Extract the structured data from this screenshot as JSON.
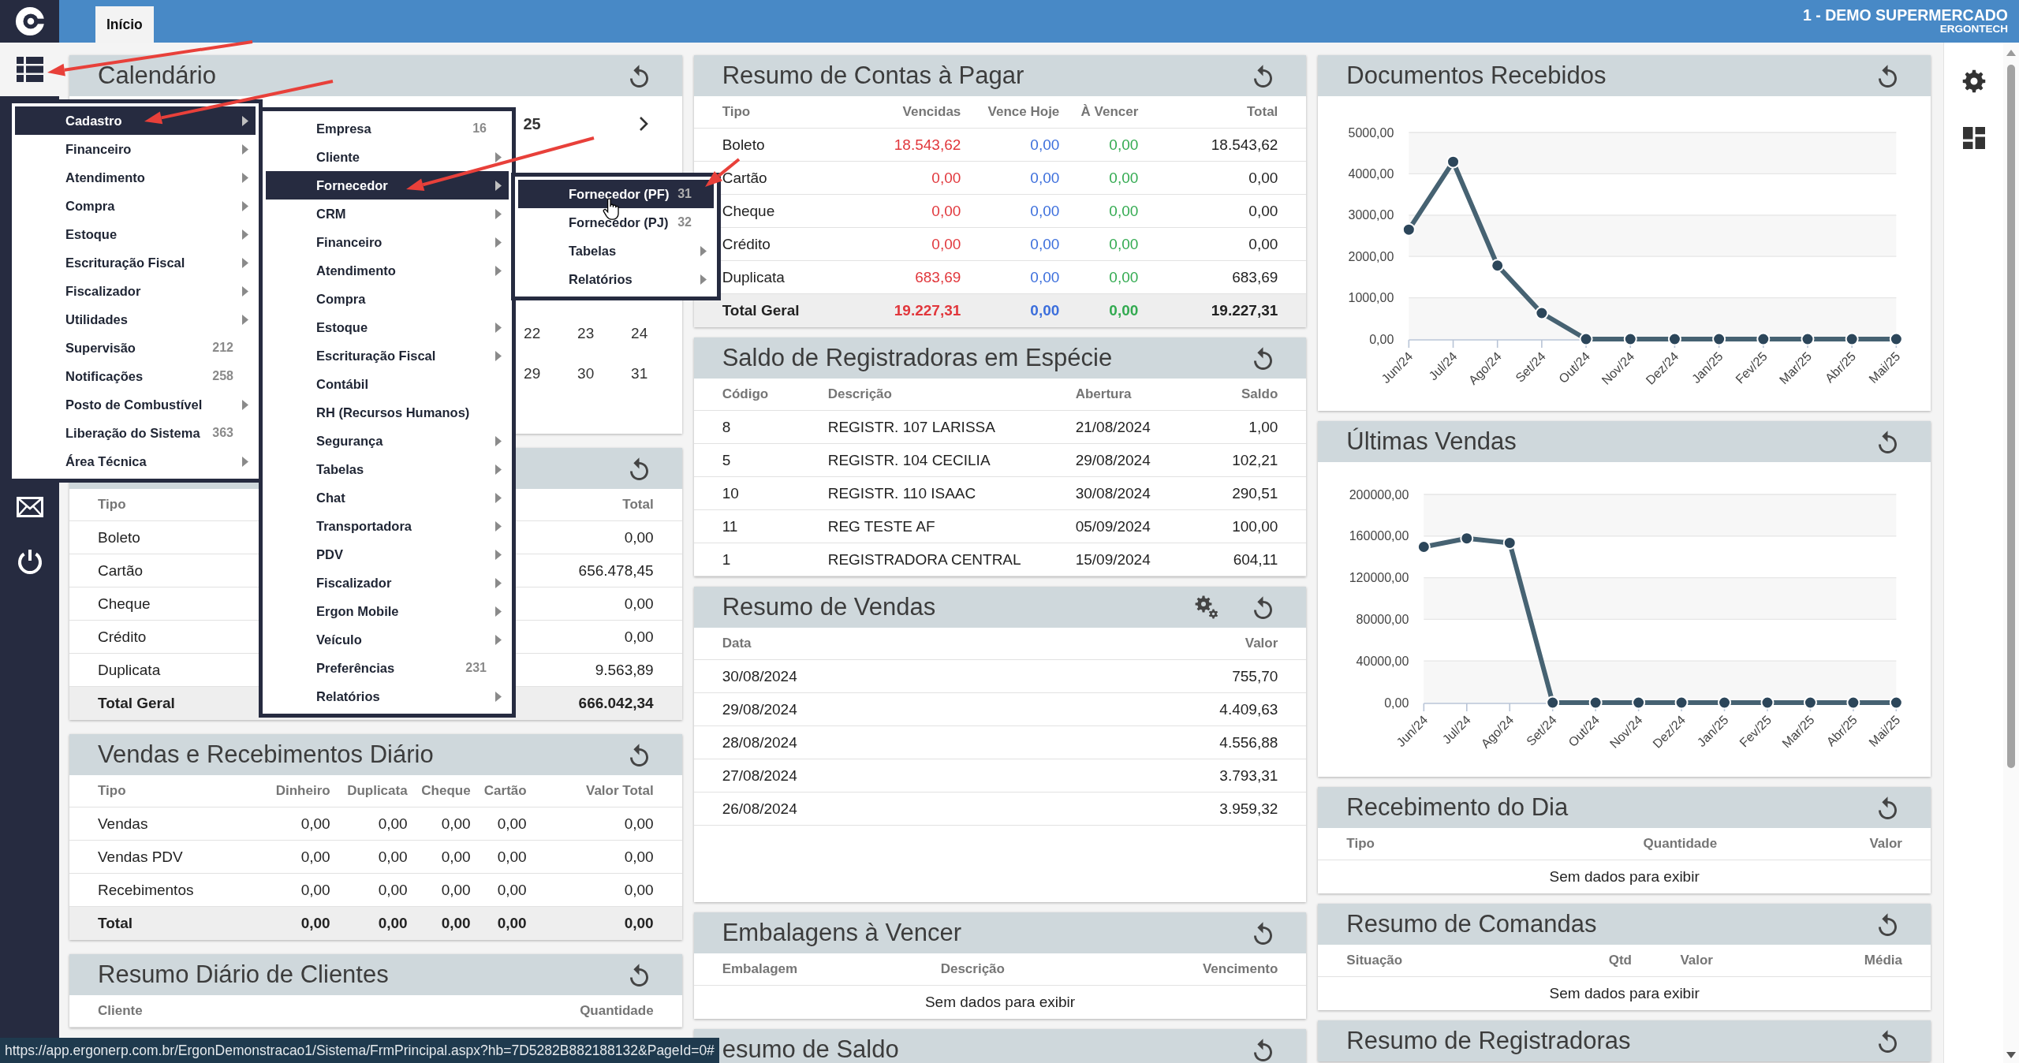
{
  "top_bar": {
    "tabs": [
      {
        "label": "Início",
        "selected": true
      }
    ],
    "company": "1 - DEMO SUPERMERCADO",
    "user": "ERGONTECH"
  },
  "sidebar": {
    "menu_button": {
      "active": true
    }
  },
  "menus": [
    {
      "items": [
        {
          "label": "Cadastro",
          "kind": "submenu",
          "selected": true
        },
        {
          "label": "Financeiro",
          "kind": "submenu",
          "selected": false
        },
        {
          "label": "Atendimento",
          "kind": "submenu",
          "selected": false
        },
        {
          "label": "Compra",
          "kind": "submenu",
          "selected": false
        },
        {
          "label": "Estoque",
          "kind": "submenu",
          "selected": false
        },
        {
          "label": "Escrituração Fiscal",
          "kind": "submenu",
          "selected": false
        },
        {
          "label": "Fiscalizador",
          "kind": "submenu",
          "selected": false
        },
        {
          "label": "Utilidades",
          "kind": "submenu",
          "selected": false
        },
        {
          "label": "Supervisão",
          "kind": "count",
          "count": "212",
          "selected": false
        },
        {
          "label": "Notificações",
          "kind": "count",
          "count": "258",
          "selected": false
        },
        {
          "label": "Posto de Combustível",
          "kind": "submenu",
          "selected": false
        },
        {
          "label": "Liberação do Sistema",
          "kind": "count",
          "count": "363",
          "selected": false
        },
        {
          "label": "Área Técnica",
          "kind": "submenu",
          "selected": false
        }
      ]
    },
    {
      "items": [
        {
          "label": "Empresa",
          "kind": "count",
          "count": "16",
          "selected": false
        },
        {
          "label": "Cliente",
          "kind": "submenu",
          "selected": false
        },
        {
          "label": "Fornecedor",
          "kind": "submenu",
          "selected": true
        },
        {
          "label": "CRM",
          "kind": "submenu",
          "selected": false
        },
        {
          "label": "Financeiro",
          "kind": "submenu",
          "selected": false
        },
        {
          "label": "Atendimento",
          "kind": "submenu",
          "selected": false
        },
        {
          "label": "Compra",
          "kind": "link",
          "selected": false
        },
        {
          "label": "Estoque",
          "kind": "submenu",
          "selected": false
        },
        {
          "label": "Escrituração Fiscal",
          "kind": "submenu",
          "selected": false
        },
        {
          "label": "Contábil",
          "kind": "link",
          "selected": false
        },
        {
          "label": "RH (Recursos Humanos)",
          "kind": "link",
          "selected": false
        },
        {
          "label": "Segurança",
          "kind": "submenu",
          "selected": false
        },
        {
          "label": "Tabelas",
          "kind": "submenu",
          "selected": false
        },
        {
          "label": "Chat",
          "kind": "submenu",
          "selected": false
        },
        {
          "label": "Transportadora",
          "kind": "submenu",
          "selected": false
        },
        {
          "label": "PDV",
          "kind": "submenu",
          "selected": false
        },
        {
          "label": "Fiscalizador",
          "kind": "submenu",
          "selected": false
        },
        {
          "label": "Ergon Mobile",
          "kind": "submenu",
          "selected": false
        },
        {
          "label": "Veículo",
          "kind": "submenu",
          "selected": false
        },
        {
          "label": "Preferências",
          "kind": "count",
          "count": "231",
          "selected": false
        },
        {
          "label": "Relatórios",
          "kind": "submenu",
          "selected": false
        }
      ]
    },
    {
      "items": [
        {
          "label": "Fornecedor (PF)",
          "kind": "count",
          "count": "31",
          "selected": true
        },
        {
          "label": "Fornecedor (PJ)",
          "kind": "count",
          "count": "32",
          "selected": false
        },
        {
          "label": "Tabelas",
          "kind": "submenu",
          "selected": false
        },
        {
          "label": "Relatórios",
          "kind": "submenu",
          "selected": false
        }
      ]
    }
  ],
  "columns": [
    {
      "cards": [
        {
          "kind": "calendar",
          "title": "Calendário",
          "month_title": "25",
          "weeks": [
            [
              "22",
              "23",
              "24"
            ],
            [
              "29",
              "30",
              "31"
            ]
          ]
        },
        {
          "kind": "table",
          "columns": [
            {
              "label": "Tipo"
            },
            {
              "label": "Total"
            }
          ],
          "rows": [
            {
              "kind": "data",
              "cells": [
                "Boleto",
                "0,00"
              ]
            },
            {
              "kind": "data",
              "cells": [
                "Cartão",
                "656.478,45"
              ]
            },
            {
              "kind": "data",
              "cells": [
                "Cheque",
                "0,00"
              ]
            },
            {
              "kind": "data",
              "cells": [
                "Crédito",
                "0,00"
              ]
            },
            {
              "kind": "data",
              "cells": [
                "Duplicata",
                "9.563,89"
              ]
            },
            {
              "kind": "total",
              "cells": [
                "Total Geral",
                "666.042,34"
              ]
            }
          ]
        },
        {
          "kind": "table",
          "title": "Vendas e Recebimentos Diário",
          "columns": [
            {
              "label": "Tipo"
            },
            {
              "label": "Dinheiro"
            },
            {
              "label": "Duplicata"
            },
            {
              "label": "Cheque"
            },
            {
              "label": "Cartão"
            },
            {
              "label": "Valor Total"
            }
          ],
          "rows": [
            {
              "kind": "data",
              "cells": [
                "Vendas",
                "0,00",
                "0,00",
                "0,00",
                "0,00",
                "0,00"
              ]
            },
            {
              "kind": "data",
              "cells": [
                "Vendas PDV",
                "0,00",
                "0,00",
                "0,00",
                "0,00",
                "0,00"
              ]
            },
            {
              "kind": "data",
              "cells": [
                "Recebimentos",
                "0,00",
                "0,00",
                "0,00",
                "0,00",
                "0,00"
              ]
            },
            {
              "kind": "total",
              "cells": [
                "Total",
                "0,00",
                "0,00",
                "0,00",
                "0,00",
                "0,00"
              ]
            }
          ]
        },
        {
          "kind": "table",
          "title": "Resumo Diário de Clientes",
          "columns": [
            {
              "label": "Cliente"
            },
            {
              "label": "Quantidade"
            }
          ]
        }
      ]
    },
    {
      "cards": [
        {
          "kind": "table",
          "title": "Resumo de Contas à Pagar",
          "columns": [
            {
              "label": "Tipo"
            },
            {
              "label": "Vencidas",
              "color": "#e1373c"
            },
            {
              "label": "Vence Hoje",
              "color": "#3b6edc"
            },
            {
              "label": "À Vencer",
              "color": "#32aa50"
            },
            {
              "label": "Total"
            }
          ],
          "rows": [
            {
              "kind": "data",
              "cells": [
                "Boleto",
                "18.543,62",
                "0,00",
                "0,00",
                "18.543,62"
              ]
            },
            {
              "kind": "data",
              "cells": [
                "Cartão",
                "0,00",
                "0,00",
                "0,00",
                "0,00"
              ]
            },
            {
              "kind": "data",
              "cells": [
                "Cheque",
                "0,00",
                "0,00",
                "0,00",
                "0,00"
              ]
            },
            {
              "kind": "data",
              "cells": [
                "Crédito",
                "0,00",
                "0,00",
                "0,00",
                "0,00"
              ]
            },
            {
              "kind": "data",
              "cells": [
                "Duplicata",
                "683,69",
                "0,00",
                "0,00",
                "683,69"
              ]
            },
            {
              "kind": "total",
              "cells": [
                "Total Geral",
                "19.227,31",
                "0,00",
                "0,00",
                "19.227,31"
              ]
            }
          ]
        },
        {
          "kind": "table",
          "title": "Saldo de Registradoras em Espécie",
          "columns": [
            {
              "label": "Código"
            },
            {
              "label": "Descrição"
            },
            {
              "label": "Abertura"
            },
            {
              "label": "Saldo"
            }
          ],
          "rows": [
            {
              "kind": "data",
              "cells": [
                "8",
                "REGISTR. 107 LARISSA",
                "21/08/2024",
                "1,00"
              ]
            },
            {
              "kind": "data",
              "cells": [
                "5",
                "REGISTR. 104 CECILIA",
                "29/08/2024",
                "102,21"
              ]
            },
            {
              "kind": "data",
              "cells": [
                "10",
                "REGISTR. 110 ISAAC",
                "30/08/2024",
                "290,51"
              ]
            },
            {
              "kind": "data",
              "cells": [
                "11",
                "REG TESTE AF",
                "05/09/2024",
                "100,00"
              ]
            },
            {
              "kind": "data",
              "cells": [
                "1",
                "REGISTRADORA CENTRAL",
                "15/09/2024",
                "604,11"
              ]
            }
          ]
        },
        {
          "kind": "table",
          "title": "Resumo de Vendas",
          "settings_button": true,
          "columns": [
            {
              "label": "Data"
            },
            {
              "label": "Valor"
            }
          ],
          "rows": [
            {
              "kind": "data",
              "cells": [
                "30/08/2024",
                "755,70"
              ]
            },
            {
              "kind": "data",
              "cells": [
                "29/08/2024",
                "4.409,63"
              ]
            },
            {
              "kind": "data",
              "cells": [
                "28/08/2024",
                "4.556,88"
              ]
            },
            {
              "kind": "data",
              "cells": [
                "27/08/2024",
                "3.793,31"
              ]
            },
            {
              "kind": "data",
              "cells": [
                "26/08/2024",
                "3.959,32"
              ]
            }
          ]
        },
        {
          "kind": "table",
          "title": "Embalagens à Vencer",
          "columns": [
            {
              "label": "Embalagem"
            },
            {
              "label": "Descrição"
            },
            {
              "label": "Vencimento"
            }
          ],
          "empty_text": "Sem dados para exibir"
        },
        {
          "kind": "table",
          "title": "esumo de Saldo"
        }
      ]
    },
    {
      "cards": [
        {
          "kind": "chart",
          "title": "Documentos Recebidos",
          "chart_data": {
            "type": "line",
            "categories": [
              "Jun/24",
              "Jul/24",
              "Ago/24",
              "Set/24",
              "Out/24",
              "Nov/24",
              "Dez/24",
              "Jan/25",
              "Fev/25",
              "Mar/25",
              "Abr/25",
              "Mai/25"
            ],
            "values": [
              2650,
              4290,
              1780,
              630,
              0,
              0,
              0,
              0,
              0,
              0,
              0,
              0
            ],
            "ylim": [
              0,
              5000
            ],
            "yticks": [
              {
                "value": 0,
                "label": "0,00"
              },
              {
                "value": 1000,
                "label": "1000,00"
              },
              {
                "value": 2000,
                "label": "2000,00"
              },
              {
                "value": 3000,
                "label": "3000,00"
              },
              {
                "value": 4000,
                "label": "4000,00"
              },
              {
                "value": 5000,
                "label": "5000,00"
              }
            ],
            "grid": true,
            "marker": true
          }
        },
        {
          "kind": "chart",
          "title": "Últimas Vendas",
          "chart_data": {
            "type": "line",
            "categories": [
              "Jun/24",
              "Jul/24",
              "Ago/24",
              "Set/24",
              "Out/24",
              "Nov/24",
              "Dez/24",
              "Jan/25",
              "Fev/25",
              "Mar/25",
              "Abr/25",
              "Mai/25"
            ],
            "values": [
              149600,
              157800,
              153500,
              0,
              0,
              0,
              0,
              0,
              0,
              0,
              0,
              0
            ],
            "ylim": [
              0,
              200000
            ],
            "yticks": [
              {
                "value": 0,
                "label": "0,00"
              },
              {
                "value": 40000,
                "label": "40000,00"
              },
              {
                "value": 80000,
                "label": "80000,00"
              },
              {
                "value": 120000,
                "label": "120000,00"
              },
              {
                "value": 160000,
                "label": "160000,00"
              },
              {
                "value": 200000,
                "label": "200000,00"
              }
            ],
            "grid": true,
            "marker": true
          }
        },
        {
          "kind": "table",
          "title": "Recebimento do Dia",
          "columns": [
            {
              "label": "Tipo"
            },
            {
              "label": "Quantidade"
            },
            {
              "label": "Valor"
            }
          ],
          "empty_text": "Sem dados para exibir"
        },
        {
          "kind": "table",
          "title": "Resumo de Comandas",
          "columns": [
            {
              "label": "Situação"
            },
            {
              "label": "Qtd"
            },
            {
              "label": "Valor"
            },
            {
              "label": "Média"
            }
          ],
          "empty_text": "Sem dados para exibir"
        },
        {
          "kind": "table",
          "title": "Resumo de Registradoras"
        }
      ]
    }
  ],
  "status_bar": {
    "url": "https://app.ergonerp.com.br/ErgonDemonstracao1/Sistema/FrmPrincipal.aspx?hb=7D5282B882188132&PageId=0#"
  }
}
